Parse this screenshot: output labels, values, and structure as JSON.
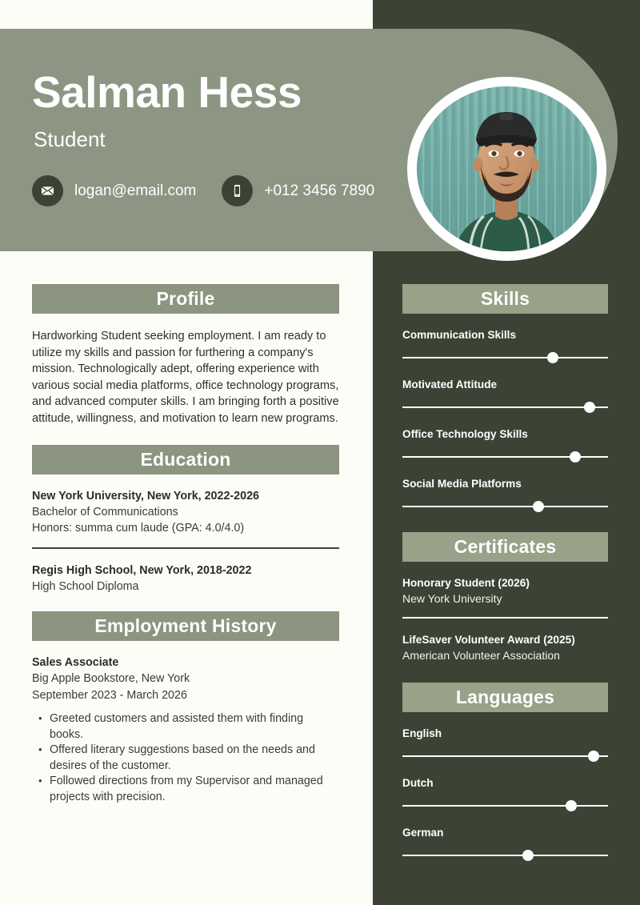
{
  "theme": {
    "header_green": "#8d9683",
    "dark_panel_green": "#3c4335",
    "section_bar_green": "#8b9580",
    "section_bar_green_dark": "#99a189",
    "page_bg": "#fdfdf8",
    "text_dark": "#2e2e2e",
    "text_light": "#ffffff"
  },
  "header": {
    "name": "Salman Hess",
    "role": "Student",
    "contacts": [
      {
        "icon": "envelope-icon",
        "text": "logan@email.com"
      },
      {
        "icon": "phone-icon",
        "text": "+012 3456 7890"
      }
    ],
    "avatar_alt": "Portrait photo of Salman Hess"
  },
  "left_column": {
    "profile": {
      "heading": "Profile",
      "body": "Hardworking Student seeking employment. I am ready to utilize my skills and passion for furthering a company's mission. Technologically adept, offering experience with various social media platforms, office technology programs, and advanced computer skills. I am bringing forth a positive attitude, willingness, and motivation to learn new programs."
    },
    "education": {
      "heading": "Education",
      "entries": [
        {
          "title": "New York University, New York, 2022-2026",
          "line1": "Bachelor of Communications",
          "line2": "Honors: summa cum laude (GPA: 4.0/4.0)"
        },
        {
          "title": "Regis High School, New York, 2018-2022",
          "line1": "High School Diploma",
          "line2": ""
        }
      ]
    },
    "employment": {
      "heading": "Employment History",
      "jobs": [
        {
          "title": "Sales Associate",
          "company": "Big Apple Bookstore, New York",
          "dates": "September 2023 - March 2026",
          "bullets": [
            "Greeted customers and assisted them with finding books.",
            "Offered literary suggestions based on the needs and desires of the customer.",
            "Followed directions from my Supervisor and managed projects with precision."
          ]
        }
      ]
    }
  },
  "right_column": {
    "skills": {
      "heading": "Skills",
      "items": [
        {
          "label": "Communication Skills",
          "level": 73
        },
        {
          "label": "Motivated Attitude",
          "level": 91
        },
        {
          "label": "Office Technology Skills",
          "level": 84
        },
        {
          "label": "Social Media Platforms",
          "level": 66
        }
      ]
    },
    "certificates": {
      "heading": "Certificates",
      "items": [
        {
          "title": "Honorary Student (2026)",
          "issuer": "New York University"
        },
        {
          "title": "LifeSaver Volunteer Award (2025)",
          "issuer": "American Volunteer Association"
        }
      ]
    },
    "languages": {
      "heading": "Languages",
      "items": [
        {
          "label": "English",
          "level": 93
        },
        {
          "label": "Dutch",
          "level": 82
        },
        {
          "label": "German",
          "level": 61
        }
      ]
    }
  }
}
